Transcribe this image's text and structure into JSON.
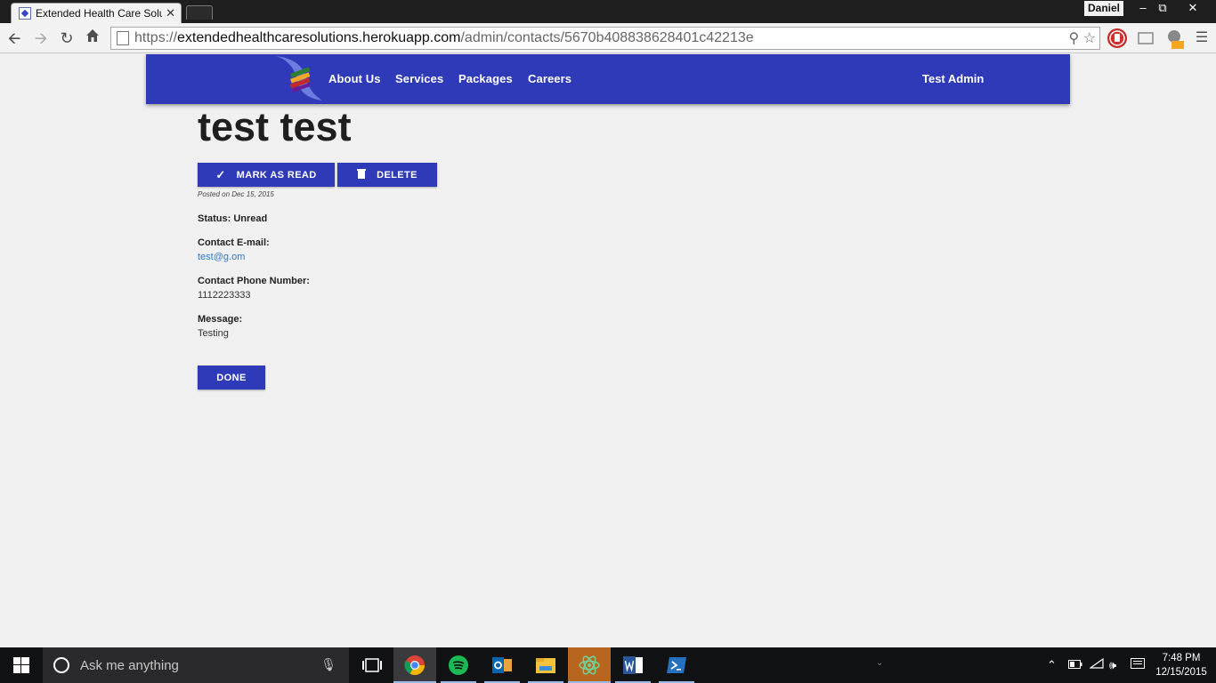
{
  "browser": {
    "tab_title": "Extended Health Care Solu",
    "tab_close": "✕",
    "user": "Daniel",
    "url_scheme": "https://",
    "url_host": "extendedhealthcaresolutions.herokuapp.com",
    "url_path": "/admin/contacts/5670b408838628401c42213e"
  },
  "navbar": {
    "links": [
      "About Us",
      "Services",
      "Packages",
      "Careers"
    ],
    "user": "Test Admin"
  },
  "contact": {
    "title": "test test",
    "mark_read_label": "MARK AS READ",
    "delete_label": "DELETE",
    "posted": "Posted on Dec 15, 2015",
    "status": "Status: Unread",
    "email_label": "Contact E-mail:",
    "email": "test@g.om",
    "phone_label": "Contact Phone Number:",
    "phone": "1112223333",
    "message_label": "Message:",
    "message": "Testing",
    "done_label": "DONE"
  },
  "taskbar": {
    "search_placeholder": "Ask me anything",
    "time": "7:48 PM",
    "date": "12/15/2015"
  },
  "colors": {
    "brand": "#2e3ab8",
    "link": "#2f79d0"
  },
  "icons": [
    "back-icon",
    "forward-icon",
    "reload-icon",
    "home-icon",
    "zoom-icon",
    "star-icon",
    "check-icon",
    "trash-icon",
    "windows-icon",
    "cortana-icon",
    "mic-icon"
  ]
}
